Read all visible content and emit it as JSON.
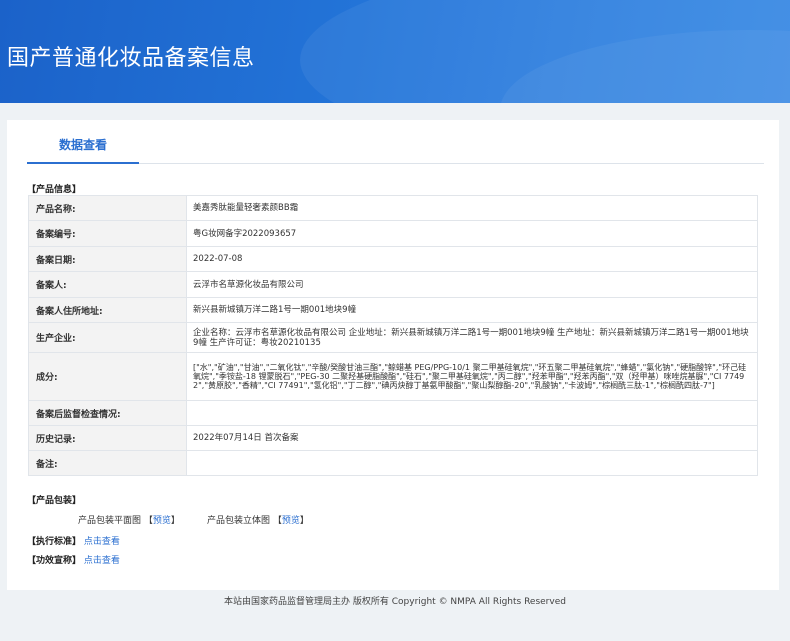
{
  "banner": {
    "title": "国产普通化妆品备案信息"
  },
  "tab": {
    "label": "数据查看"
  },
  "product_info": {
    "section_title": "【产品信息】",
    "rows": [
      {
        "key": "产品名称:",
        "value": "美嘉秀肽能量轻奢素颜BB霜"
      },
      {
        "key": "备案编号:",
        "value": "粤G妆网备字2022093657"
      },
      {
        "key": "备案日期:",
        "value": "2022-07-08"
      },
      {
        "key": "备案人:",
        "value": "云浮市名草源化妆品有限公司"
      },
      {
        "key": "备案人住所地址:",
        "value": "新兴县新城镇万洋二路1号一期001地块9幢"
      },
      {
        "key": "生产企业:",
        "value": "企业名称：云浮市名草源化妆品有限公司 企业地址：新兴县新城镇万洋二路1号一期001地块9幢 生产地址：新兴县新城镇万洋二路1号一期001地块9幢 生产许可证：粤妆20210135"
      },
      {
        "key": "成分:",
        "value": "[\"水\",\"矿油\",\"甘油\",\"二氧化钛\",\"辛酸/癸酸甘油三酯\",\"鲸蜡基 PEG/PPG-10/1 聚二甲基硅氧烷\",\"环五聚二甲基硅氧烷\",\"蜂蜡\",\"氯化钠\",\"硬脂酸锌\",\"环己硅氧烷\",\"季铵盐-18 锂蒙脱石\",\"PEG-30 二聚羟基硬脂酸酯\",\"硅石\",\"聚二甲基硅氧烷\",\"丙二醇\",\"羟苯甲酯\",\"羟苯丙酯\",\"双（羟甲基）咪唑烷基脲\",\"CI 77492\",\"黄原胶\",\"香精\",\"CI 77491\",\"氢化铝\",\"丁二醇\",\"碘丙炔醇丁基氨甲酸酯\",\"聚山梨醇酯-20\",\"乳酸钠\",\"卡波姆\",\"棕榈酰三肽-1\",\"棕榈酰四肽-7\"]"
      },
      {
        "key": "备案后监督检查情况:",
        "value": ""
      },
      {
        "key": "历史记录:",
        "value": "2022年07月14日 首次备案"
      },
      {
        "key": "备注:",
        "value": ""
      }
    ]
  },
  "packaging": {
    "section_title": "【产品包装】",
    "flat_label": "产品包装平面图",
    "flat_link": "预览",
    "solid_label": "产品包装立体图",
    "solid_link": "预览"
  },
  "standard": {
    "label": "【执行标准】",
    "link": "点击查看"
  },
  "claims": {
    "label": "【功效宣称】",
    "link": "点击查看"
  },
  "footer": {
    "text": "本站由国家药品监督管理局主办 版权所有 Copyright © NMPA All Rights Reserved"
  },
  "colors": {
    "banner": "#2374d8",
    "accent": "#2b6fd0",
    "table_border": "#a8c3e8"
  }
}
